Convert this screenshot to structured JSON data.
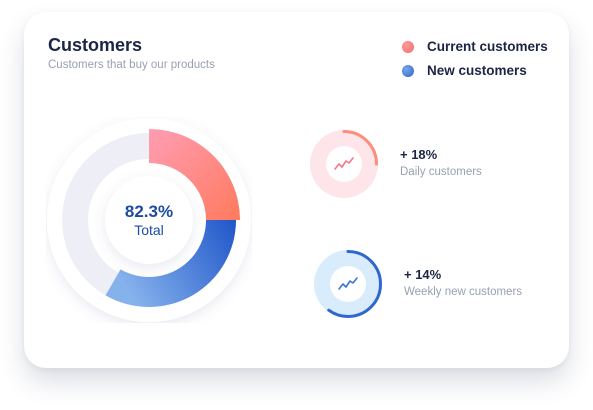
{
  "card": {
    "title": "Customers",
    "subtitle": "Customers that buy our products"
  },
  "legend": [
    {
      "label": "Current customers",
      "color": "#f47f7f"
    },
    {
      "label": "New customers",
      "color": "#3d73d4"
    }
  ],
  "donut": {
    "value_text": "82.3%",
    "label": "Total",
    "segments": [
      {
        "name": "current",
        "fraction": 0.25,
        "color_start": "#ff9db3",
        "color_end": "#ff7a5e"
      },
      {
        "name": "new",
        "fraction": 0.3333,
        "color_start": "#1f56c9",
        "color_end": "#86b2ec"
      }
    ],
    "track_color": "#eeeef7"
  },
  "stats": [
    {
      "value": "+ 18%",
      "label": "Daily customers",
      "progress": 0.25,
      "ring_color": "#ff8d7d",
      "bg_color": "#fde5ea",
      "icon": "trend-line-icon",
      "icon_color": "#f2778a"
    },
    {
      "value": "+ 14%",
      "label": "Weekly new customers",
      "progress": 0.6,
      "ring_color": "#2f67d1",
      "bg_color": "#d9ecfb",
      "icon": "trend-line-icon",
      "icon_color": "#3b74d6"
    }
  ]
}
